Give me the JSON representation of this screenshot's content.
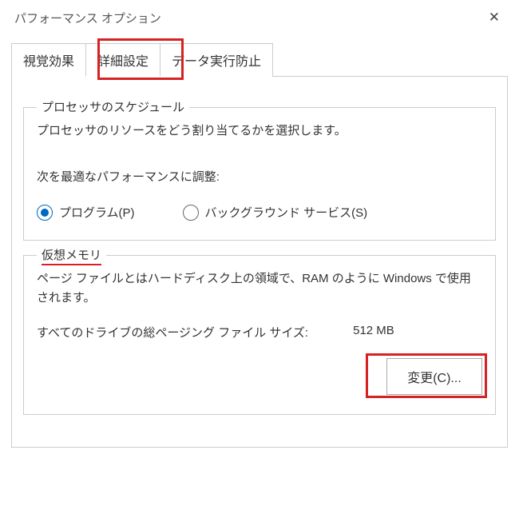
{
  "window": {
    "title": "パフォーマンス オプション"
  },
  "tabs": [
    {
      "label": "視覚効果"
    },
    {
      "label": "詳細設定"
    },
    {
      "label": "データ実行防止"
    }
  ],
  "processor": {
    "legend": "プロセッサのスケジュール",
    "desc": "プロセッサのリソースをどう割り当てるかを選択します。",
    "subhead": "次を最適なパフォーマンスに調整:",
    "radios": {
      "programs": "プログラム(P)",
      "background": "バックグラウンド サービス(S)"
    }
  },
  "vmem": {
    "legend": "仮想メモリ",
    "desc": "ページ ファイルとはハードディスク上の領域で、RAM のように Windows で使用されます。",
    "total_label": "すべてのドライブの総ページング ファイル サイズ:",
    "total_value": "512 MB",
    "change_button": "変更(C)..."
  }
}
